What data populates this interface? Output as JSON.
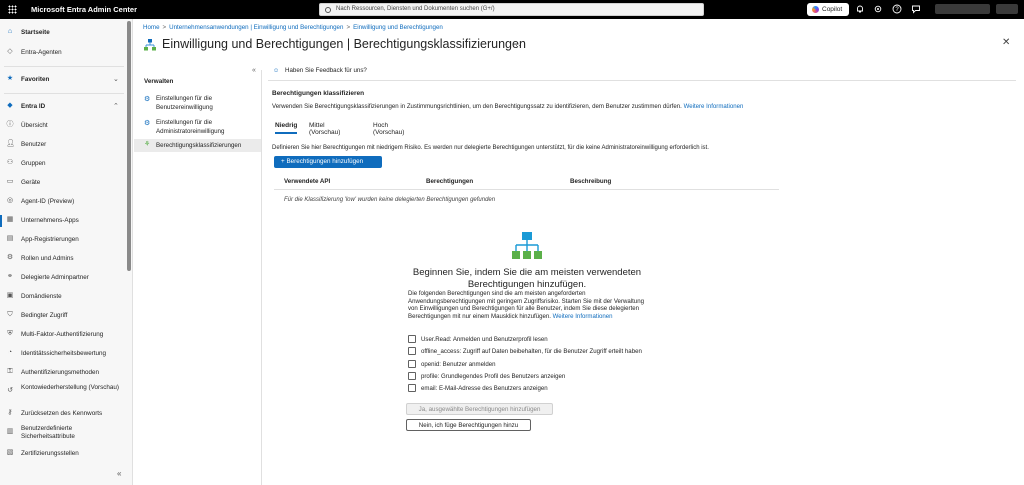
{
  "topbar": {
    "app_title": "Microsoft Entra Admin Center",
    "search_placeholder": "Nach Ressourcen, Diensten und Dokumenten suchen (G+/)",
    "copilot_label": "Copilot"
  },
  "sidebar": {
    "items": [
      {
        "label": "Startseite",
        "icon": "home-icon",
        "bold": true
      },
      {
        "label": "Entra-Agenten",
        "icon": "agent-icon"
      },
      {
        "label": "Favoriten",
        "icon": "star-icon",
        "bold": true
      },
      {
        "label": "Entra ID",
        "icon": "diamond-icon",
        "bold": true
      },
      {
        "label": "Übersicht",
        "icon": "info-icon"
      },
      {
        "label": "Benutzer",
        "icon": "user-icon"
      },
      {
        "label": "Gruppen",
        "icon": "groups-icon"
      },
      {
        "label": "Geräte",
        "icon": "device-icon"
      },
      {
        "label": "Agent-ID (Preview)",
        "icon": "agent-id-icon"
      },
      {
        "label": "Unternehmens-Apps",
        "icon": "apps-icon"
      },
      {
        "label": "App-Registrierungen",
        "icon": "app-reg-icon"
      },
      {
        "label": "Rollen und Admins",
        "icon": "roles-icon"
      },
      {
        "label": "Delegierte Adminpartner",
        "icon": "partner-icon"
      },
      {
        "label": "Domändienste",
        "icon": "domain-icon"
      },
      {
        "label": "Bedingter Zugriff",
        "icon": "conditional-icon"
      },
      {
        "label": "Multi-Faktor-Authentifizierung",
        "icon": "mfa-icon"
      },
      {
        "label": "Identitätssicherheitsbewertung",
        "icon": "score-icon"
      },
      {
        "label": "Authentifizierungsmethoden",
        "icon": "auth-icon"
      },
      {
        "label": "Kontowiederherstellung (Vorschau)",
        "icon": "recovery-icon"
      },
      {
        "label": "Zurücksetzen des Kennworts",
        "icon": "key-icon"
      },
      {
        "label": "Benutzerdefinierte Sicherheitsattribute",
        "icon": "attribute-icon"
      },
      {
        "label": "Zertifizierungsstellen",
        "icon": "certificate-icon"
      }
    ]
  },
  "breadcrumb": {
    "home": "Home",
    "level1": "Unternehmensanwendungen | Einwilligung und Berechtigungen",
    "level2": "Einwilligung und Berechtigungen"
  },
  "page": {
    "title": "Einwilligung und Berechtigungen | Berechtigungsklassifizierungen",
    "more": "…"
  },
  "leftnav": {
    "heading": "Verwalten",
    "items": [
      {
        "label": "Einstellungen für die Benutzereinwilligung"
      },
      {
        "label": "Einstellungen für die Administratoreinwilligung"
      },
      {
        "label": "Berechtigungsklassifizierungen"
      }
    ]
  },
  "feedback": "Haben Sie Feedback für uns?",
  "section": {
    "heading": "Berechtigungen klassifizieren",
    "description": "Verwenden Sie Berechtigungsklassifizierungen in Zustimmungsrichtlinien, um den Berechtigungssatz zu identifizieren, dem Benutzer zustimmen dürfen.",
    "more_info": "Weitere Informationen"
  },
  "tabs": [
    "Niedrig",
    "Mittel (Vorschau)",
    "Hoch (Vorschau)"
  ],
  "tab_info": "Definieren Sie hier Berechtigungen mit niedrigem Risiko. Es werden nur delegierte Berechtigungen unterstützt, für die keine Administratoreinwilligung erforderlich ist.",
  "add_button": "Berechtigungen hinzufügen",
  "table": {
    "columns": [
      "Verwendete API",
      "Berechtigungen",
      "Beschreibung"
    ],
    "empty": "Für die Klassifizierung 'low' wurden keine delegierten Berechtigungen gefunden"
  },
  "getting_started": {
    "title": "Beginnen Sie, indem Sie die am meisten verwendeten Berechtigungen hinzufügen.",
    "description": "Die folgenden Berechtigungen sind die am meisten angeforderten Anwendungsberechtigungen mit geringem Zugriffsrisiko. Starten Sie mit der Verwaltung von Einwilligungen und Berechtigungen für alle Benutzer, indem Sie diese delegierten Berechtigungen mit nur einem Mausklick hinzufügen.",
    "more_info": "Weitere Informationen",
    "options": [
      "User.Read: Anmelden und Benutzerprofil lesen",
      "offline_access: Zugriff auf Daten beibehalten, für die Benutzer Zugriff erteilt haben",
      "openid: Benutzer anmelden",
      "profile: Grundlegendes Profil des Benutzers anzeigen",
      "email: E-Mail-Adresse des Benutzers anzeigen"
    ],
    "confirm_button": "Ja, ausgewählte Berechtigungen hinzufügen",
    "decline_button": "Nein, ich füge Berechtigungen hinzu"
  },
  "colors": {
    "accent": "#0f6cbd",
    "topbar": "#000000"
  }
}
